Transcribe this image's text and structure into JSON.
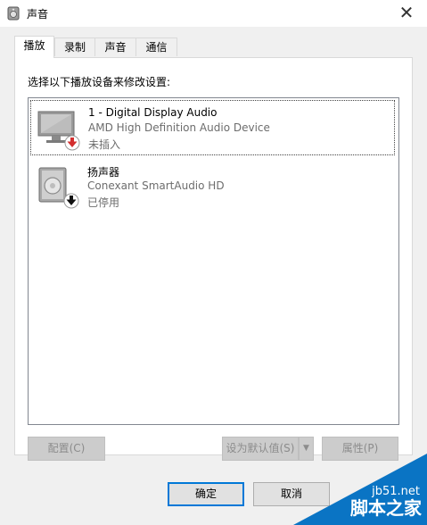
{
  "window": {
    "title": "声音",
    "close_glyph": "✕"
  },
  "tabs": [
    {
      "label": "播放",
      "active": true
    },
    {
      "label": "录制",
      "active": false
    },
    {
      "label": "声音",
      "active": false
    },
    {
      "label": "通信",
      "active": false
    }
  ],
  "panel": {
    "instruction": "选择以下播放设备来修改设置:"
  },
  "devices": [
    {
      "name": "1 - Digital Display Audio",
      "description": "AMD High Definition Audio Device",
      "status": "未插入",
      "icon": "monitor-icon",
      "badge": "red-down-arrow-badge",
      "selected": true
    },
    {
      "name": "扬声器",
      "description": "Conexant SmartAudio HD",
      "status": "已停用",
      "icon": "speaker-icon",
      "badge": "black-down-arrow-badge",
      "selected": false
    }
  ],
  "buttons": {
    "configure": "配置(C)",
    "set_default": "设为默认值(S)",
    "properties": "属性(P)",
    "ok": "确定",
    "cancel": "取消"
  },
  "watermark": {
    "site": "jb51.net",
    "name": "脚本之家"
  },
  "colors": {
    "accent": "#0078d7",
    "badge_red": "#d32f2f",
    "watermark_blue": "#0a74c4"
  }
}
